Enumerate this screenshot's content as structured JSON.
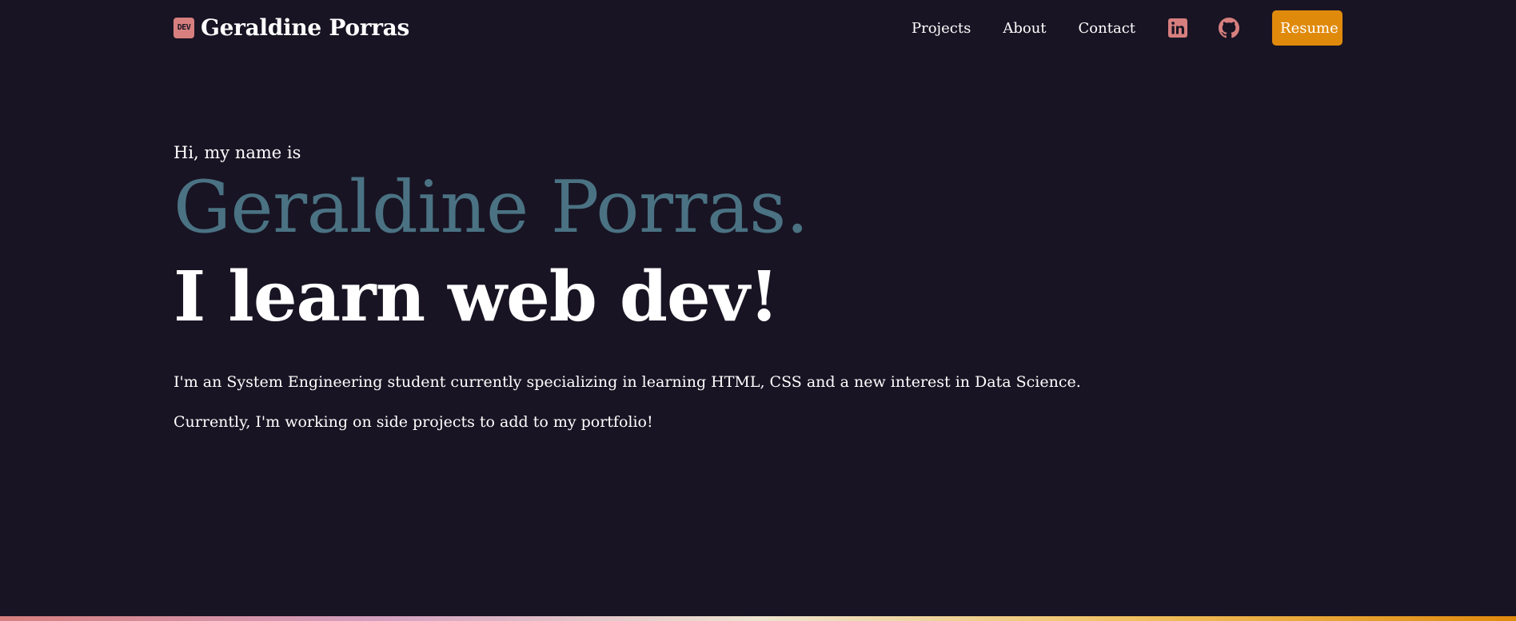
{
  "nav": {
    "brand_badge": "DEV",
    "brand_name": "Geraldine Porras",
    "links": [
      "Projects",
      "About",
      "Contact"
    ],
    "icons": [
      "linkedin-icon",
      "github-icon"
    ],
    "resume_label": "Resume"
  },
  "hero": {
    "greeting": "Hi, my name is",
    "name": "Geraldine Porras.",
    "tagline": "I learn web dev!",
    "paragraph1": "I'm an System Engineering student currently specializing in learning HTML, CSS and a new interest in Data Science.",
    "paragraph2": "Currently, I'm working on side projects to add to my portfolio!"
  },
  "colors": {
    "background": "#181423",
    "accent_pink": "#d77f7f",
    "name_teal": "#4a7283",
    "resume_orange": "#e08a0c",
    "text": "#ffffff"
  }
}
